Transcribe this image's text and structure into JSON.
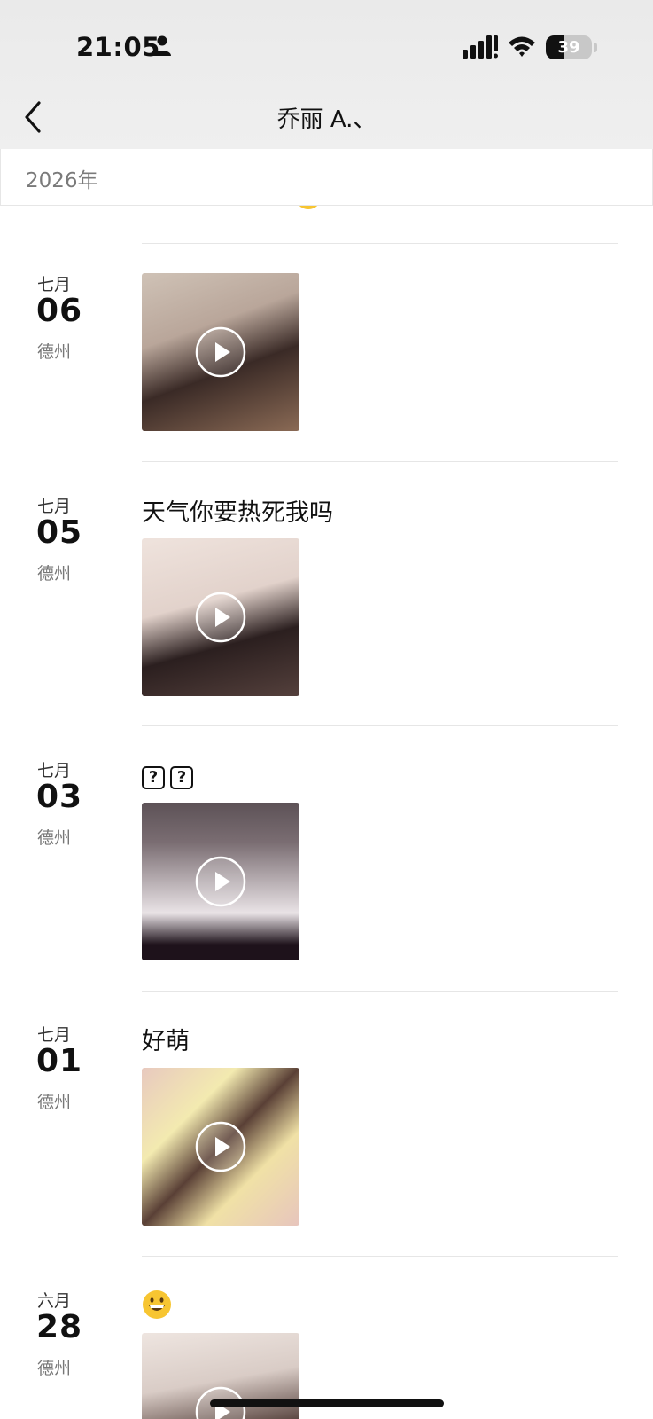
{
  "status_bar": {
    "time": "21:05",
    "battery_level": "39",
    "icons": [
      "person-icon",
      "signal-icon",
      "wifi-icon",
      "battery-icon"
    ]
  },
  "nav": {
    "back_icon": "chevron-left-icon",
    "title": "乔丽 A.、"
  },
  "year_header": "2026年",
  "partial_top_entry": {
    "caption": "…",
    "emoji": "grinning-face-icon"
  },
  "entries": [
    {
      "month": "七月",
      "day": "06",
      "location": "德州",
      "caption": "",
      "media": "video",
      "thumb_colors": [
        "#c9b8a8",
        "#3a2a26",
        "#d8c2ae"
      ]
    },
    {
      "month": "七月",
      "day": "05",
      "location": "德州",
      "caption": "天气你要热死我吗",
      "media": "video",
      "thumb_colors": [
        "#e8d8d2",
        "#2b1f1f",
        "#f1e4de"
      ]
    },
    {
      "month": "七月",
      "day": "03",
      "location": "德州",
      "caption": "??",
      "media": "video",
      "thumb_colors": [
        "#6d6066",
        "#1e121b",
        "#ece6ea"
      ]
    },
    {
      "month": "七月",
      "day": "01",
      "location": "德州",
      "caption": "好萌",
      "media": "video",
      "thumb_colors": [
        "#e8c9bf",
        "#f3eab0",
        "#5a4036"
      ]
    },
    {
      "month": "六月",
      "day": "28",
      "location": "德州",
      "caption": "",
      "media": "video",
      "caption_emoji": "grinning-face-icon",
      "thumb_colors": [
        "#d9ccc6",
        "#4a3530",
        "#eee5e0"
      ]
    }
  ]
}
